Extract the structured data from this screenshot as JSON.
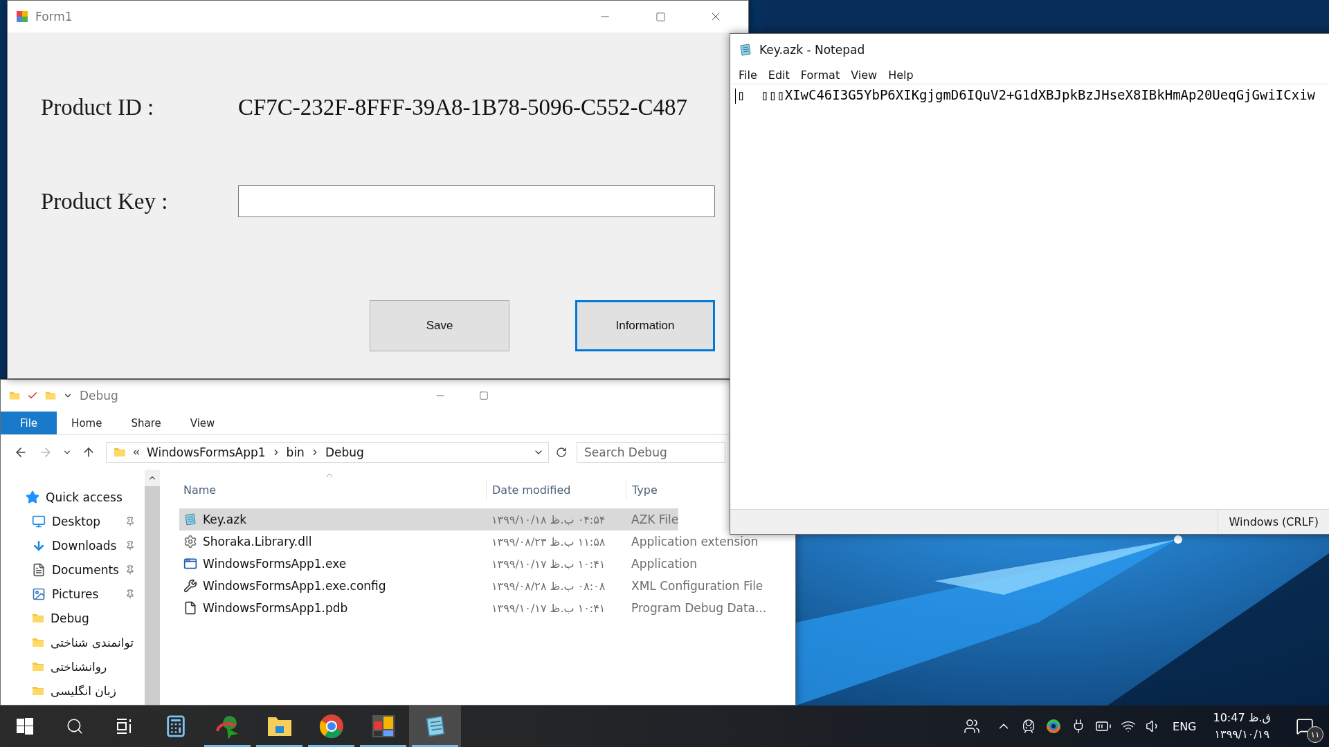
{
  "form": {
    "title": "Form1",
    "fields": [
      {
        "label": "Product ID :",
        "kind": "value",
        "value": "CF7C-232F-8FFF-39A8-1B78-5096-C552-C487"
      },
      {
        "label": "Product Key :",
        "kind": "input"
      }
    ],
    "buttons": [
      {
        "label": "Save",
        "focused": false
      },
      {
        "label": "Information",
        "focused": true
      }
    ]
  },
  "notepad": {
    "title": "Key.azk - Notepad",
    "menu": [
      "File",
      "Edit",
      "Format",
      "View",
      "Help"
    ],
    "text": "▯  ▯▯▯XIwC46I3G5YbP6XIKgjgmD6IQuV2+G1dXBJpkBzJHseX8IBkHmAp20UeqGjGwiICxiw",
    "status": "Windows (CRLF)"
  },
  "explorer": {
    "title": "Debug",
    "ribbon": [
      {
        "label": "File",
        "kind": "file"
      },
      {
        "label": "Home",
        "kind": "tab"
      },
      {
        "label": "Share",
        "kind": "tab"
      },
      {
        "label": "View",
        "kind": "tab"
      }
    ],
    "path": [
      "WindowsFormsApp1",
      "bin",
      "Debug"
    ],
    "search": {
      "placeholder": "Search Debug"
    },
    "nav": [
      {
        "label": "Quick access",
        "kind": "quick",
        "pinned": false
      },
      {
        "label": "Desktop",
        "kind": "desktop",
        "pinned": true
      },
      {
        "label": "Downloads",
        "kind": "downloads",
        "pinned": true
      },
      {
        "label": "Documents",
        "kind": "documents",
        "pinned": true
      },
      {
        "label": "Pictures",
        "kind": "pictures",
        "pinned": true
      },
      {
        "label": "Debug",
        "kind": "folder",
        "pinned": false
      },
      {
        "label": "توانمندی شناختی",
        "kind": "folder",
        "pinned": false
      },
      {
        "label": "روانشناختی",
        "kind": "folder",
        "pinned": false
      },
      {
        "label": "زبان انگلیسی",
        "kind": "folder",
        "pinned": false
      }
    ],
    "columns": [
      "Name",
      "Date modified",
      "Type"
    ],
    "files": [
      {
        "name": "Key.azk",
        "kind": "notepad",
        "date": "۰۴:۵۴ ب.ظ ۱۳۹۹/۱۰/۱۸",
        "type": "AZK File",
        "selected": true
      },
      {
        "name": "Shoraka.Library.dll",
        "kind": "dll",
        "date": "۱۱:۵۸ ب.ظ ۱۳۹۹/۰۸/۲۳",
        "type": "Application extension",
        "selected": false
      },
      {
        "name": "WindowsFormsApp1.exe",
        "kind": "exe",
        "date": "۱۰:۴۱ ب.ظ ۱۳۹۹/۱۰/۱۷",
        "type": "Application",
        "selected": false
      },
      {
        "name": "WindowsFormsApp1.exe.config",
        "kind": "config",
        "date": "۰۸:۰۸ ب.ظ ۱۳۹۹/۰۸/۲۸",
        "type": "XML Configuration File",
        "selected": false
      },
      {
        "name": "WindowsFormsApp1.pdb",
        "kind": "pdb",
        "date": "۱۰:۴۱ ب.ظ ۱۳۹۹/۱۰/۱۷",
        "type": "Program Debug Data...",
        "selected": false
      }
    ]
  },
  "taskbar": {
    "apps": [
      {
        "kind": "calculator",
        "running": false,
        "active": false
      },
      {
        "kind": "download-manager",
        "running": true,
        "active": false
      },
      {
        "kind": "file-explorer",
        "running": true,
        "active": false
      },
      {
        "kind": "browser",
        "running": true,
        "active": false
      },
      {
        "kind": "tiles",
        "running": true,
        "active": false
      },
      {
        "kind": "notepad",
        "running": true,
        "active": true
      }
    ],
    "language": "ENG",
    "time": "10:47 ق.ظ",
    "date": "۱۳۹۹/۱۰/۱۹",
    "notifications": "۱۱"
  }
}
